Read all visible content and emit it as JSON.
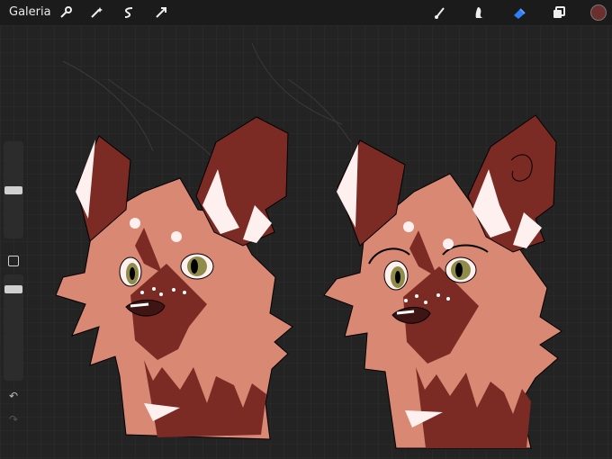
{
  "app": {
    "gallery_label": "Galeria"
  },
  "toolbar": {
    "left_icons": [
      "wrench-icon",
      "magic-wand-icon",
      "selection-icon",
      "transform-icon"
    ],
    "right_icons": [
      "brush-icon",
      "smudge-icon",
      "eraser-icon",
      "layers-icon",
      "color-swatch"
    ],
    "accent_color": "#2f7ff6",
    "current_color": "#6b2f2d"
  },
  "sidebar": {
    "brush_size_slider_fraction": 0.55,
    "opacity_slider_fraction": 0.78,
    "modifier_button": "square-modifier",
    "undo_icon": "undo-icon",
    "redo_icon": "redo-icon"
  },
  "canvas": {
    "background_color": "#232323",
    "grid_color": "#2f2f2f",
    "artwork": [
      "cat-head-left",
      "cat-head-right"
    ]
  }
}
